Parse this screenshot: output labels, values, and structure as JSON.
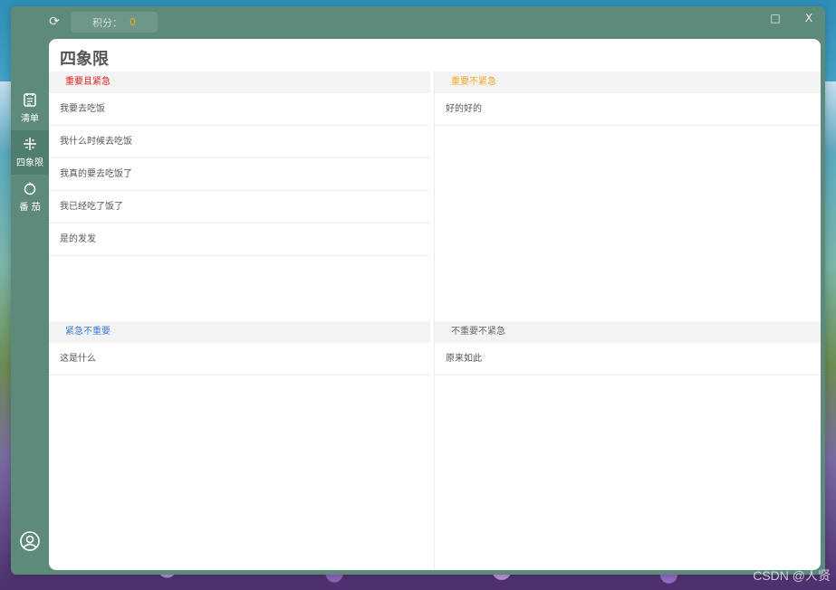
{
  "titlebar": {
    "score_label": "积分：",
    "score_value": "0",
    "minimize_glyph": "□",
    "close_glyph": "X"
  },
  "sidebar": {
    "items": [
      {
        "label": "清单",
        "icon": "checklist-icon"
      },
      {
        "label": "四象限",
        "icon": "quadrant-icon"
      },
      {
        "label": "番 茄",
        "icon": "tomato-icon"
      }
    ]
  },
  "main": {
    "title": "四象限",
    "quadrants": [
      {
        "label": "重要且紧急",
        "color": "#e02020",
        "items": [
          "我要去吃饭",
          "我什么时候去吃饭",
          "我真的要去吃饭了",
          "我已经吃了饭了",
          "是的发发"
        ]
      },
      {
        "label": "重要不紧急",
        "color": "#f5a623",
        "items": [
          "好的好的"
        ]
      },
      {
        "label": "紧急不重要",
        "color": "#3a7bd5",
        "items": [
          "这是什么"
        ]
      },
      {
        "label": "不重要不紧急",
        "color": "#666666",
        "items": [
          "原来如此"
        ]
      }
    ]
  },
  "watermark": "CSDN @人贤"
}
